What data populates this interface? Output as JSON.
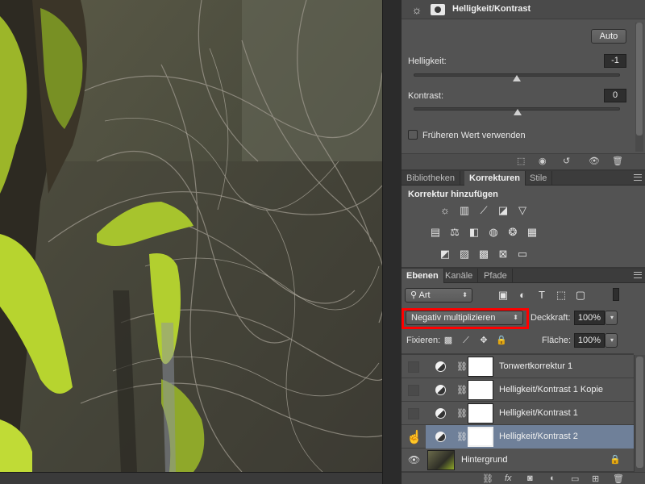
{
  "properties": {
    "title": "Helligkeit/Kontrast",
    "auto_label": "Auto",
    "brightness_label": "Helligkeit:",
    "brightness_value": "-1",
    "contrast_label": "Kontrast:",
    "contrast_value": "0",
    "legacy_label": "Früheren Wert verwenden"
  },
  "adjust_tabs": [
    "Bibliotheken",
    "Korrekturen",
    "Stile"
  ],
  "adjustments": {
    "heading": "Korrektur hinzufügen"
  },
  "layer_tabs": [
    "Ebenen",
    "Kanäle",
    "Pfade"
  ],
  "layers_panel": {
    "filter_value": "Art",
    "blend_mode": "Negativ multiplizieren",
    "opacity_label": "Deckkraft:",
    "opacity_value": "100%",
    "lock_label": "Fixieren:",
    "fill_label": "Fläche:",
    "fill_value": "100%"
  },
  "layers": [
    {
      "name": "Tonwertkorrektur 1"
    },
    {
      "name": "Helligkeit/Kontrast 1 Kopie"
    },
    {
      "name": "Helligkeit/Kontrast 1"
    },
    {
      "name": "Helligkeit/Kontrast 2"
    },
    {
      "name": "Hintergrund"
    }
  ],
  "colors": {
    "selected_layer": "#6f8099",
    "highlight": "#ff0000",
    "moss": "#b7d42f"
  }
}
